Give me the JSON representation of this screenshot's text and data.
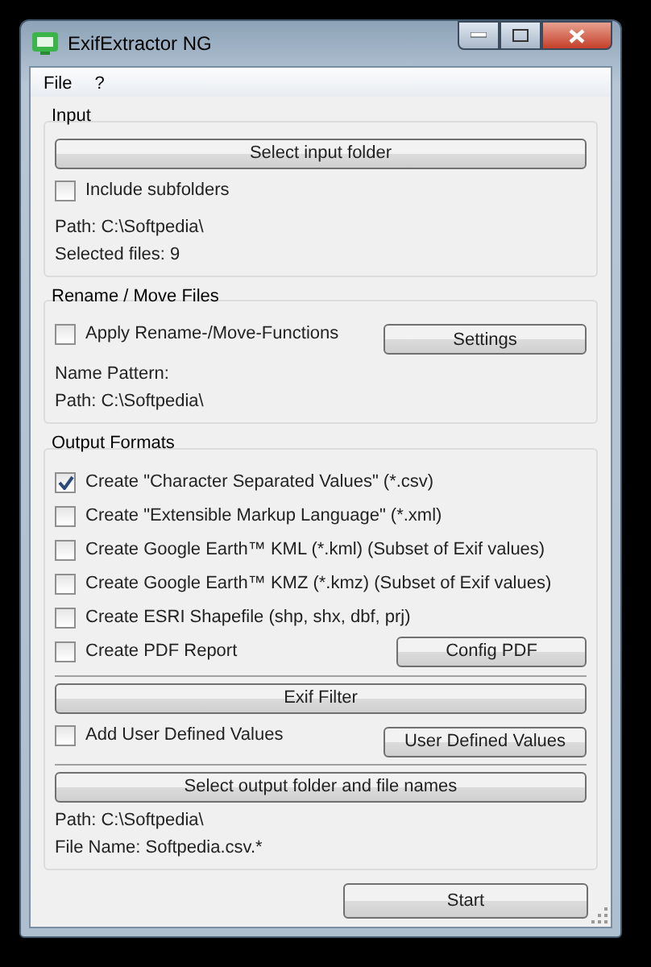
{
  "window": {
    "title": "ExifExtractor NG"
  },
  "menu": [
    "File",
    "?"
  ],
  "input": {
    "title": "Input",
    "select_button": "Select input folder",
    "include_subfolders": {
      "label": "Include subfolders",
      "checked": false
    },
    "path": "Path: C:\\Softpedia\\",
    "selected_files": "Selected files: 9"
  },
  "rename": {
    "title": "Rename / Move Files",
    "apply": {
      "label": "Apply Rename-/Move-Functions",
      "checked": false
    },
    "settings_button": "Settings",
    "name_pattern": "Name Pattern:",
    "path": "Path: C:\\Softpedia\\"
  },
  "output": {
    "title": "Output Formats",
    "formats": [
      {
        "label": "Create \"Character Separated Values\" (*.csv)",
        "checked": true
      },
      {
        "label": "Create \"Extensible Markup Language\" (*.xml)",
        "checked": false
      },
      {
        "label": "Create Google Earth™ KML (*.kml) (Subset of Exif values)",
        "checked": false
      },
      {
        "label": "Create Google Earth™ KMZ (*.kmz) (Subset of Exif values)",
        "checked": false
      },
      {
        "label": "Create ESRI Shapefile (shp, shx, dbf, prj)",
        "checked": false
      },
      {
        "label": "Create PDF Report",
        "checked": false,
        "button": "Config PDF"
      }
    ],
    "exif_filter_button": "Exif Filter",
    "add_user_values": {
      "label": "Add User Defined Values",
      "checked": false
    },
    "user_values_button": "User Defined Values",
    "select_output_button": "Select output folder and file names",
    "path": "Path: C:\\Softpedia\\",
    "file_name": "File Name: Softpedia.csv.*"
  },
  "start_button": "Start"
}
